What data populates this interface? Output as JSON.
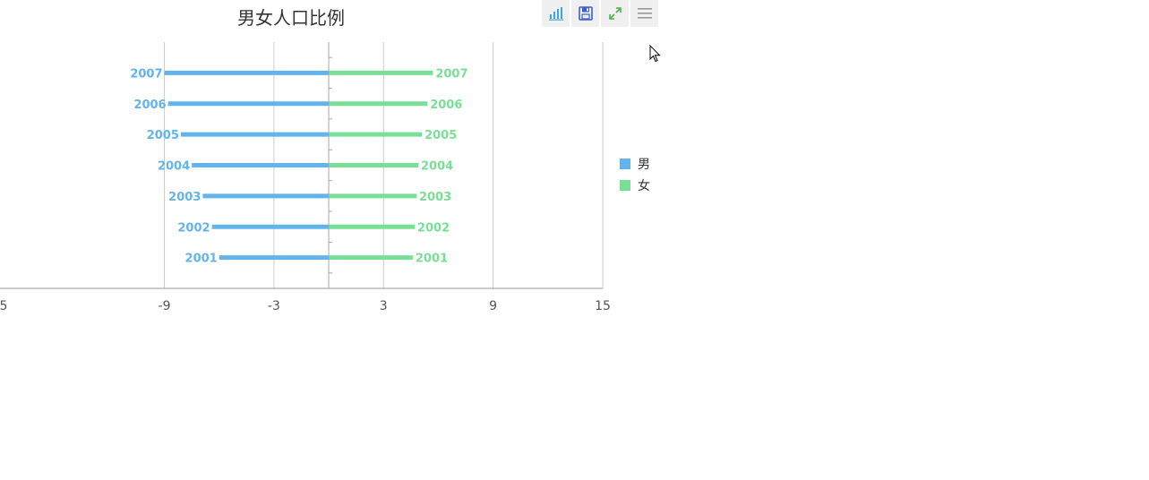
{
  "title": "男女人口比例",
  "toolbar": {
    "icons": [
      "bar-chart-icon",
      "save-icon",
      "fullscreen-icon",
      "menu-icon"
    ],
    "colors": {
      "bar_chart": "#3aa8e0",
      "save": "#3a5fcd",
      "fullscreen": "#4caf50",
      "menu": "#999999"
    }
  },
  "legend": {
    "items": [
      {
        "label": "男",
        "color": "#62b4ea"
      },
      {
        "label": "女",
        "color": "#7adf96"
      }
    ],
    "placement": "right"
  },
  "chart_data": {
    "type": "bar",
    "orientation": "horizontal",
    "categories": [
      "2001",
      "2002",
      "2003",
      "2004",
      "2005",
      "2006",
      "2007"
    ],
    "series": [
      {
        "name": "男",
        "color": "#62b4ea",
        "values": [
          -6.0,
          -6.4,
          -6.9,
          -7.5,
          -8.1,
          -8.8,
          -9.0
        ]
      },
      {
        "name": "女",
        "color": "#7adf96",
        "values": [
          4.6,
          4.7,
          4.8,
          4.9,
          5.1,
          5.4,
          5.7
        ]
      }
    ],
    "xlim": [
      -18,
      15
    ],
    "xticks": [
      "5",
      "-9",
      "-3",
      "3",
      "9",
      "15"
    ],
    "grid": true,
    "show_category_labels_on_bars": true
  }
}
